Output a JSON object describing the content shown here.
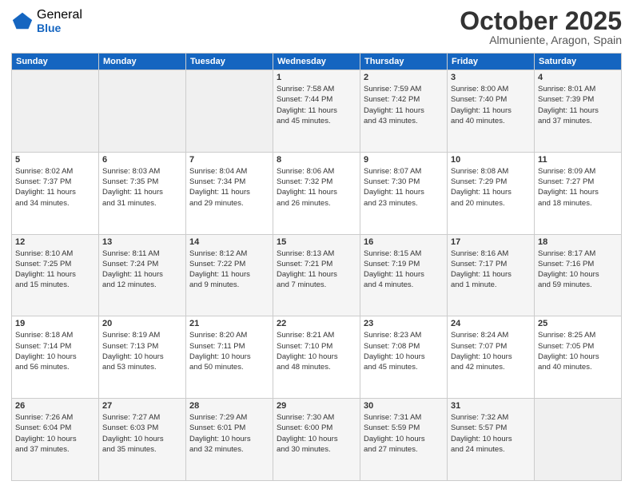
{
  "logo": {
    "general": "General",
    "blue": "Blue"
  },
  "header": {
    "month": "October 2025",
    "location": "Almuniente, Aragon, Spain"
  },
  "days_of_week": [
    "Sunday",
    "Monday",
    "Tuesday",
    "Wednesday",
    "Thursday",
    "Friday",
    "Saturday"
  ],
  "weeks": [
    [
      {
        "day": "",
        "info": ""
      },
      {
        "day": "",
        "info": ""
      },
      {
        "day": "",
        "info": ""
      },
      {
        "day": "1",
        "info": "Sunrise: 7:58 AM\nSunset: 7:44 PM\nDaylight: 11 hours\nand 45 minutes."
      },
      {
        "day": "2",
        "info": "Sunrise: 7:59 AM\nSunset: 7:42 PM\nDaylight: 11 hours\nand 43 minutes."
      },
      {
        "day": "3",
        "info": "Sunrise: 8:00 AM\nSunset: 7:40 PM\nDaylight: 11 hours\nand 40 minutes."
      },
      {
        "day": "4",
        "info": "Sunrise: 8:01 AM\nSunset: 7:39 PM\nDaylight: 11 hours\nand 37 minutes."
      }
    ],
    [
      {
        "day": "5",
        "info": "Sunrise: 8:02 AM\nSunset: 7:37 PM\nDaylight: 11 hours\nand 34 minutes."
      },
      {
        "day": "6",
        "info": "Sunrise: 8:03 AM\nSunset: 7:35 PM\nDaylight: 11 hours\nand 31 minutes."
      },
      {
        "day": "7",
        "info": "Sunrise: 8:04 AM\nSunset: 7:34 PM\nDaylight: 11 hours\nand 29 minutes."
      },
      {
        "day": "8",
        "info": "Sunrise: 8:06 AM\nSunset: 7:32 PM\nDaylight: 11 hours\nand 26 minutes."
      },
      {
        "day": "9",
        "info": "Sunrise: 8:07 AM\nSunset: 7:30 PM\nDaylight: 11 hours\nand 23 minutes."
      },
      {
        "day": "10",
        "info": "Sunrise: 8:08 AM\nSunset: 7:29 PM\nDaylight: 11 hours\nand 20 minutes."
      },
      {
        "day": "11",
        "info": "Sunrise: 8:09 AM\nSunset: 7:27 PM\nDaylight: 11 hours\nand 18 minutes."
      }
    ],
    [
      {
        "day": "12",
        "info": "Sunrise: 8:10 AM\nSunset: 7:25 PM\nDaylight: 11 hours\nand 15 minutes."
      },
      {
        "day": "13",
        "info": "Sunrise: 8:11 AM\nSunset: 7:24 PM\nDaylight: 11 hours\nand 12 minutes."
      },
      {
        "day": "14",
        "info": "Sunrise: 8:12 AM\nSunset: 7:22 PM\nDaylight: 11 hours\nand 9 minutes."
      },
      {
        "day": "15",
        "info": "Sunrise: 8:13 AM\nSunset: 7:21 PM\nDaylight: 11 hours\nand 7 minutes."
      },
      {
        "day": "16",
        "info": "Sunrise: 8:15 AM\nSunset: 7:19 PM\nDaylight: 11 hours\nand 4 minutes."
      },
      {
        "day": "17",
        "info": "Sunrise: 8:16 AM\nSunset: 7:17 PM\nDaylight: 11 hours\nand 1 minute."
      },
      {
        "day": "18",
        "info": "Sunrise: 8:17 AM\nSunset: 7:16 PM\nDaylight: 10 hours\nand 59 minutes."
      }
    ],
    [
      {
        "day": "19",
        "info": "Sunrise: 8:18 AM\nSunset: 7:14 PM\nDaylight: 10 hours\nand 56 minutes."
      },
      {
        "day": "20",
        "info": "Sunrise: 8:19 AM\nSunset: 7:13 PM\nDaylight: 10 hours\nand 53 minutes."
      },
      {
        "day": "21",
        "info": "Sunrise: 8:20 AM\nSunset: 7:11 PM\nDaylight: 10 hours\nand 50 minutes."
      },
      {
        "day": "22",
        "info": "Sunrise: 8:21 AM\nSunset: 7:10 PM\nDaylight: 10 hours\nand 48 minutes."
      },
      {
        "day": "23",
        "info": "Sunrise: 8:23 AM\nSunset: 7:08 PM\nDaylight: 10 hours\nand 45 minutes."
      },
      {
        "day": "24",
        "info": "Sunrise: 8:24 AM\nSunset: 7:07 PM\nDaylight: 10 hours\nand 42 minutes."
      },
      {
        "day": "25",
        "info": "Sunrise: 8:25 AM\nSunset: 7:05 PM\nDaylight: 10 hours\nand 40 minutes."
      }
    ],
    [
      {
        "day": "26",
        "info": "Sunrise: 7:26 AM\nSunset: 6:04 PM\nDaylight: 10 hours\nand 37 minutes."
      },
      {
        "day": "27",
        "info": "Sunrise: 7:27 AM\nSunset: 6:03 PM\nDaylight: 10 hours\nand 35 minutes."
      },
      {
        "day": "28",
        "info": "Sunrise: 7:29 AM\nSunset: 6:01 PM\nDaylight: 10 hours\nand 32 minutes."
      },
      {
        "day": "29",
        "info": "Sunrise: 7:30 AM\nSunset: 6:00 PM\nDaylight: 10 hours\nand 30 minutes."
      },
      {
        "day": "30",
        "info": "Sunrise: 7:31 AM\nSunset: 5:59 PM\nDaylight: 10 hours\nand 27 minutes."
      },
      {
        "day": "31",
        "info": "Sunrise: 7:32 AM\nSunset: 5:57 PM\nDaylight: 10 hours\nand 24 minutes."
      },
      {
        "day": "",
        "info": ""
      }
    ]
  ]
}
